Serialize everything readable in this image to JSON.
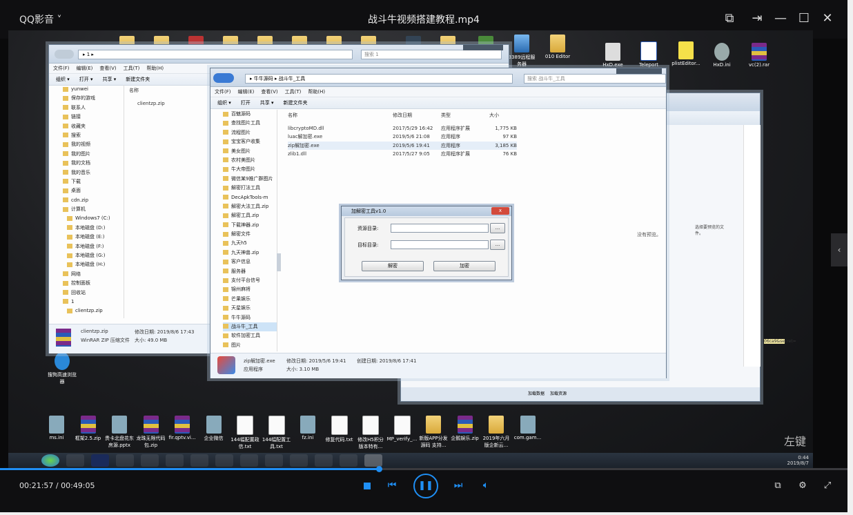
{
  "player": {
    "app_name": "QQ影音",
    "video_title": "战斗牛视频搭建教程.mp4",
    "time_current": "00:21:57",
    "time_separator": " / ",
    "time_total": "00:49:05",
    "progress_fraction": 0.447
  },
  "video": {
    "watermark": "左键",
    "desktop_icons_top": [
      {
        "label": "3389远程服务器",
        "icon": "monitor-icon"
      },
      {
        "label": "010 Editor",
        "icon": "folder-icon"
      },
      {
        "label": "HxD.exe",
        "icon": "hxd-icon"
      },
      {
        "label": "Teleport",
        "icon": "teleport-icon"
      },
      {
        "label": "plistEditor...",
        "icon": "editor-icon"
      },
      {
        "label": "HxD.ini",
        "icon": "gear-icon"
      },
      {
        "label": "vc(2).rar",
        "icon": "archive-icon"
      }
    ],
    "desktop_icons_left": [
      {
        "label": "搜狗高速浏览器",
        "icon": "browser-icon"
      }
    ],
    "desktop_icons_bottom": [
      {
        "label": "ms.ini",
        "icon": "gear-icon"
      },
      {
        "label": "框架2.5.zip",
        "icon": "archive-icon"
      },
      {
        "label": "贵卡北盘花东房源.pptx",
        "icon": "document-icon"
      },
      {
        "label": "龙珠无限代码包.zip",
        "icon": "archive-icon"
      },
      {
        "label": "fir.qptv.vi...",
        "icon": "archive-icon"
      },
      {
        "label": "企业微信",
        "icon": "chat-icon"
      },
      {
        "label": "144幅配置政信.txt",
        "icon": "text-icon"
      },
      {
        "label": "144幅配置工具.txt",
        "icon": "text-icon"
      },
      {
        "label": "fz.ini",
        "icon": "gear-icon"
      },
      {
        "label": "修复代码.txt",
        "icon": "text-icon"
      },
      {
        "label": "修改H5积分版本特有...",
        "icon": "text-icon"
      },
      {
        "label": "MP_verify_...",
        "icon": "text-icon"
      },
      {
        "label": "新版APP分发源码 支持...",
        "icon": "folder-icon"
      },
      {
        "label": "企鹅娱乐.zip",
        "icon": "archive-icon"
      },
      {
        "label": "2019年六月版企新云...",
        "icon": "folder-icon"
      },
      {
        "label": "com.gam...",
        "icon": "apk-icon"
      }
    ],
    "taskbar": {
      "clock_time": "0:44",
      "clock_date": "2019/8/7"
    }
  },
  "explorer_back": {
    "path": "▸ 1 ▸",
    "search": "搜索 1",
    "menu": [
      "文件(F)",
      "编辑(E)",
      "查看(V)",
      "工具(T)",
      "帮助(H)"
    ],
    "toolbar": [
      "组织 ▾",
      "打开 ▾",
      "共享 ▾",
      "新建文件夹"
    ],
    "nav": [
      "yunwei",
      "保存的游戏",
      "联系人",
      "链接",
      "收藏夹",
      "搜索",
      "我的视频",
      "我的图片",
      "我的文档",
      "我的音乐",
      "下载",
      "桌面",
      "cdn.zip",
      "计算机",
      "Windows7 (C:)",
      "本地磁盘 (D:)",
      "本地磁盘 (E:)",
      "本地磁盘 (F:)",
      "本地磁盘 (G:)",
      "本地磁盘 (H:)",
      "网络",
      "控制面板",
      "回收站",
      "1",
      "clientzp.zip"
    ],
    "col_name": "名称",
    "files": [
      "clientzp.zip"
    ],
    "detail_name": "clientzp.zip",
    "detail_date": "修改日期: 2019/8/6 17:43",
    "detail_type": "WinRAR ZIP 压缩文件",
    "detail_size": "大小: 49.0 MB"
  },
  "explorer_front": {
    "path": "▸ 牛牛源码 ▸ 战斗牛_工具",
    "search": "搜索 战斗牛_工具",
    "menu": [
      "文件(F)",
      "编辑(E)",
      "查看(V)",
      "工具(T)",
      "帮助(H)"
    ],
    "toolbar": [
      "组织 ▾",
      "打开",
      "共享 ▾",
      "新建文件夹"
    ],
    "nav": [
      "百魅源码",
      "查找图片工具",
      "流程图片",
      "宝宝客户收集",
      "美女图片",
      "农村美图片",
      "牛大帝图片",
      "微信某9推广群图片",
      "解密打法工具",
      "DecApkTools-m",
      "解密大法工具.zip",
      "解密工具.zip",
      "下载神器.zip",
      "解密文件",
      "九天h5",
      "九天神兽.zip",
      "客户信息",
      "服务器",
      "支付平台信号",
      "锦州麻将",
      "芒果娱乐",
      "天星娱乐",
      "牛牛源码",
      "战斗牛_工具",
      "软件加密工具",
      "图片"
    ],
    "columns": {
      "name": "名称",
      "date": "修改日期",
      "type": "类型",
      "size": "大小"
    },
    "files": [
      {
        "name": "libcryptoMD.dll",
        "date": "2017/5/29 16:42",
        "type": "应用程序扩展",
        "size": "1,775 KB"
      },
      {
        "name": "luac解加密.exe",
        "date": "2019/5/6 21:08",
        "type": "应用程序",
        "size": "97 KB"
      },
      {
        "name": "zip解加密.exe",
        "date": "2019/5/6 19:41",
        "type": "应用程序",
        "size": "3,185 KB"
      },
      {
        "name": "zlib1.dll",
        "date": "2017/5/27 9:05",
        "type": "应用程序扩展",
        "size": "76 KB"
      }
    ],
    "preview_text": "没有预览。",
    "detail_name": "zip解加密.exe",
    "detail_modified": "修改日期: 2019/5/6 19:41",
    "detail_created": "创建日期: 2019/8/6 17:41",
    "detail_type": "应用程序",
    "detail_size": "大小: 3.10 MB"
  },
  "explorer_right": {
    "preview_text": "选择要预览的文件。",
    "status_tabs": [
      "加载数据",
      "加载资源"
    ],
    "fragment": "06ca9&secret="
  },
  "dialog": {
    "title": "加解密工具v1.0",
    "source_label": "资源目录:",
    "target_label": "目标目录:",
    "browse_label": "...",
    "decrypt_label": "解密",
    "encrypt_label": "加密",
    "close_label": "x"
  }
}
